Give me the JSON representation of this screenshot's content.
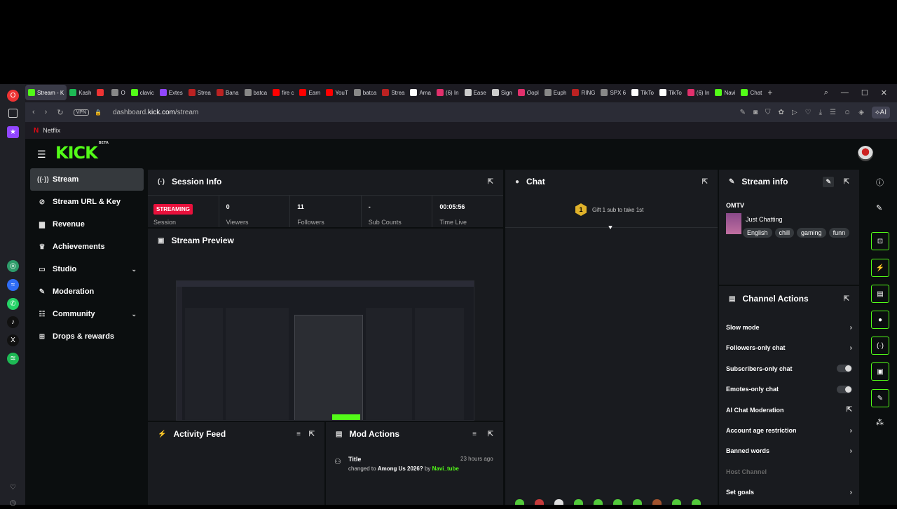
{
  "browser": {
    "tabs": [
      {
        "label": "Stream - K",
        "color": "#53fc18",
        "active": true
      },
      {
        "label": "Kash",
        "color": "#1db954"
      },
      {
        "label": "",
        "color": "#e33"
      },
      {
        "label": "O",
        "color": "#888"
      },
      {
        "label": "clavic",
        "color": "#53fc18"
      },
      {
        "label": "Extes",
        "color": "#9146ff"
      },
      {
        "label": "Strea",
        "color": "#b22"
      },
      {
        "label": "Bana",
        "color": "#b22"
      },
      {
        "label": "batca",
        "color": "#888"
      },
      {
        "label": "fire c",
        "color": "#f00"
      },
      {
        "label": "Earn",
        "color": "#f00"
      },
      {
        "label": "YouT",
        "color": "#f00"
      },
      {
        "label": "batca",
        "color": "#888"
      },
      {
        "label": "Strea",
        "color": "#b22"
      },
      {
        "label": "Ama",
        "color": "#fff"
      },
      {
        "label": "(6) In",
        "color": "#e1306c"
      },
      {
        "label": "Ease",
        "color": "#ccc"
      },
      {
        "label": "Sign",
        "color": "#ccc"
      },
      {
        "label": "Oopl",
        "color": "#e1306c"
      },
      {
        "label": "Euph",
        "color": "#888"
      },
      {
        "label": "RING",
        "color": "#b22"
      },
      {
        "label": "SPX 6",
        "color": "#888"
      },
      {
        "label": "TikTo",
        "color": "#fff"
      },
      {
        "label": "TikTo",
        "color": "#fff"
      },
      {
        "label": "(6) In",
        "color": "#e1306c"
      },
      {
        "label": "Navi",
        "color": "#53fc18"
      },
      {
        "label": "Chat",
        "color": "#53fc18"
      }
    ],
    "url_prefix": "dashboard.",
    "url_domain": "kick.com",
    "url_path": "/stream",
    "vpn_label": "VPN",
    "ai_label": "AI",
    "bookmark": "Netflix"
  },
  "header": {
    "logo": "KICK",
    "logo_badge": "BETA"
  },
  "sidebar": {
    "items": [
      {
        "label": "Stream",
        "icon": "((·))",
        "active": true
      },
      {
        "label": "Stream URL & Key",
        "icon": "⊘"
      },
      {
        "label": "Revenue",
        "icon": "▆"
      },
      {
        "label": "Achievements",
        "icon": "♛"
      },
      {
        "label": "Studio",
        "icon": "▭",
        "expand": true
      },
      {
        "label": "Moderation",
        "icon": "✎"
      },
      {
        "label": "Community",
        "icon": "☷",
        "expand": true
      },
      {
        "label": "Drops & rewards",
        "icon": "⊞"
      }
    ]
  },
  "session": {
    "title": "Session Info",
    "status": "STREAMING",
    "stats": [
      {
        "value": "",
        "label": "Session"
      },
      {
        "value": "0",
        "label": "Viewers"
      },
      {
        "value": "11",
        "label": "Followers"
      },
      {
        "value": "-",
        "label": "Sub Counts"
      },
      {
        "value": "00:05:56",
        "label": "Time Live"
      }
    ]
  },
  "preview": {
    "title": "Stream Preview"
  },
  "chat": {
    "title": "Chat",
    "gift_count": "1",
    "gift_text": "Gift 1 sub to take 1st"
  },
  "stream_info": {
    "title": "Stream info",
    "channel": "OMTV",
    "category": "Just Chatting",
    "tags": [
      "English",
      "chill",
      "gaming",
      "funn"
    ]
  },
  "channel_actions": {
    "title": "Channel Actions",
    "rows": [
      {
        "label": "Slow mode",
        "control": "arrow"
      },
      {
        "label": "Followers-only chat",
        "control": "arrow"
      },
      {
        "label": "Subscribers-only chat",
        "control": "toggle"
      },
      {
        "label": "Emotes-only chat",
        "control": "toggle"
      },
      {
        "label": "AI Chat Moderation",
        "control": "external"
      },
      {
        "label": "Account age restriction",
        "control": "arrow"
      },
      {
        "label": "Banned words",
        "control": "arrow"
      },
      {
        "label": "Host Channel",
        "control": "none",
        "muted": true
      },
      {
        "label": "Set goals",
        "control": "arrow"
      }
    ]
  },
  "activity": {
    "title": "Activity Feed"
  },
  "mod_actions": {
    "title": "Mod Actions",
    "entry": {
      "title": "Title",
      "time": "23 hours ago",
      "prefix": "changed to ",
      "value": "Among Us 2026?",
      "by": " by ",
      "user": "Navi_tube"
    }
  },
  "colors": {
    "accent": "#53fc18",
    "live": "#e9113c"
  }
}
